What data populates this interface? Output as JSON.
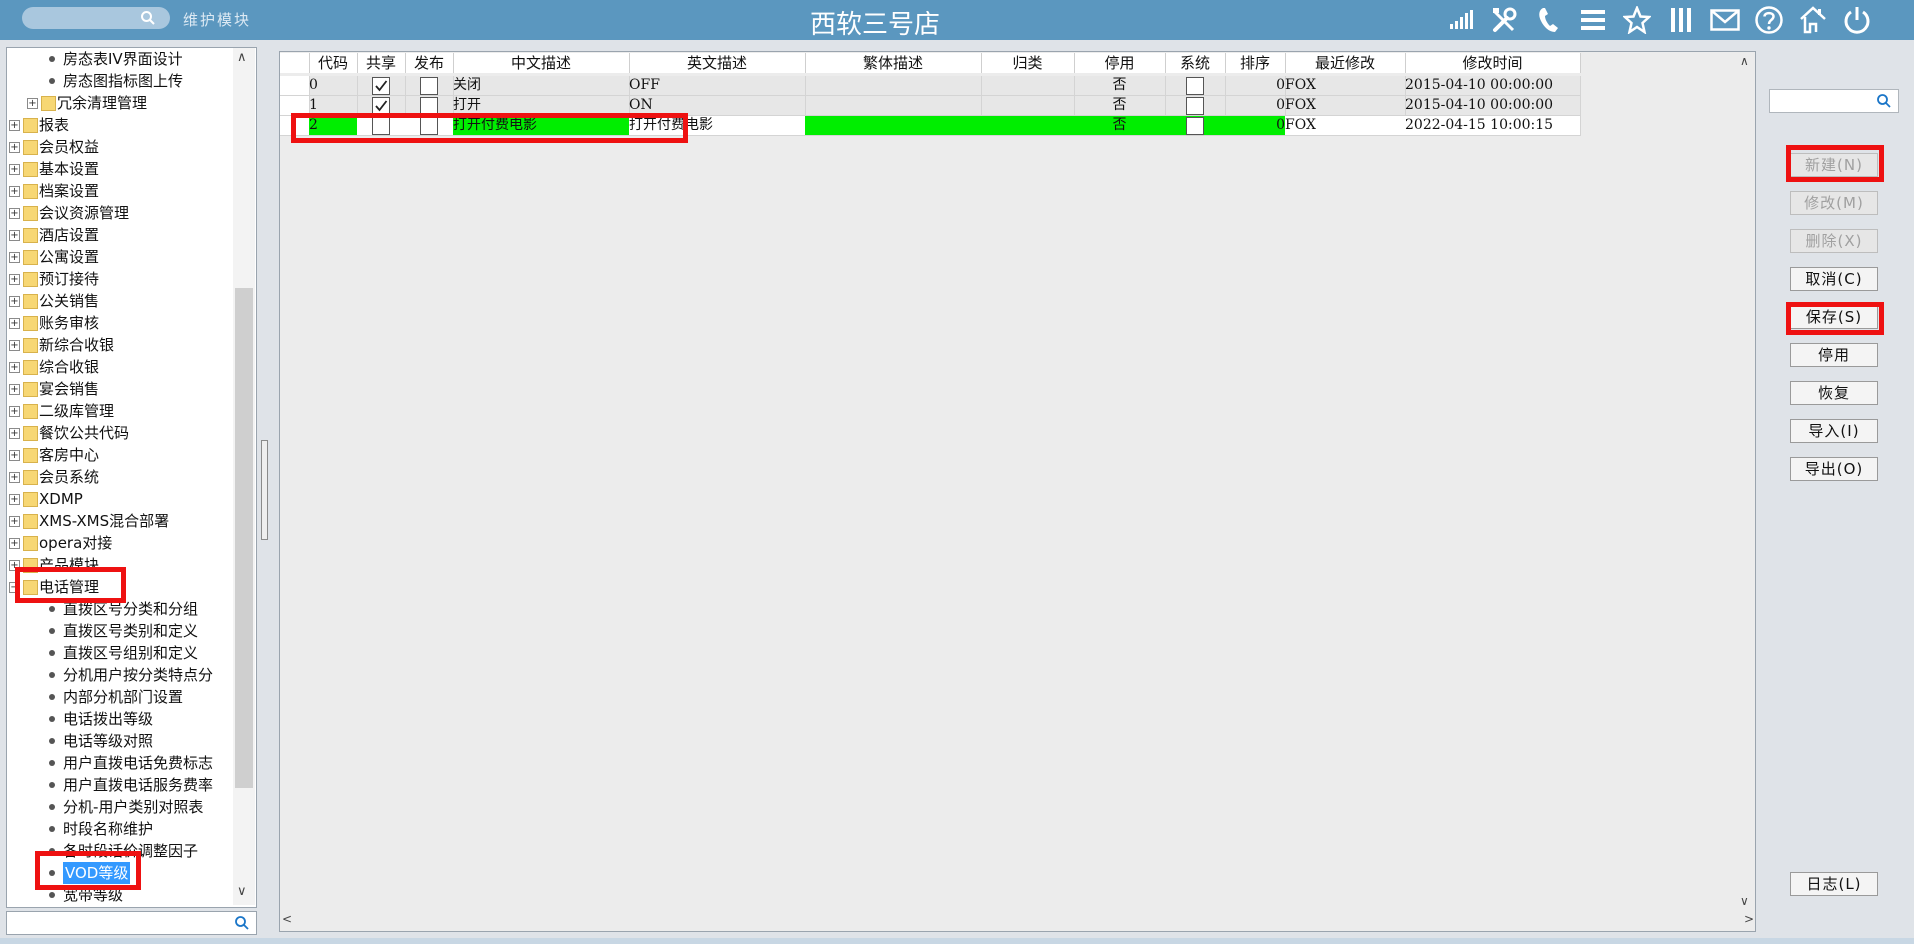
{
  "header": {
    "title": "西软三号店",
    "module_label": "维护模块",
    "icons": [
      "signal-icon",
      "tools-icon",
      "phone-icon",
      "menu-icon",
      "star-icon",
      "columns-icon",
      "mail-icon",
      "help-icon",
      "house-icon",
      "power-icon"
    ]
  },
  "tree": {
    "items": [
      {
        "label": "房态表IV界面设计",
        "type": "leaf",
        "level": 2
      },
      {
        "label": "房态图指标图上传",
        "type": "leaf",
        "level": 2
      },
      {
        "label": "冗余清理管理",
        "type": "folder",
        "level": 1
      },
      {
        "label": "报表",
        "type": "folder",
        "level": 0
      },
      {
        "label": "会员权益",
        "type": "folder",
        "level": 0
      },
      {
        "label": "基本设置",
        "type": "folder",
        "level": 0
      },
      {
        "label": "档案设置",
        "type": "folder",
        "level": 0
      },
      {
        "label": "会议资源管理",
        "type": "folder",
        "level": 0
      },
      {
        "label": "酒店设置",
        "type": "folder",
        "level": 0
      },
      {
        "label": "公寓设置",
        "type": "folder",
        "level": 0
      },
      {
        "label": "预订接待",
        "type": "folder",
        "level": 0
      },
      {
        "label": "公关销售",
        "type": "folder",
        "level": 0
      },
      {
        "label": "账务审核",
        "type": "folder",
        "level": 0
      },
      {
        "label": "新综合收银",
        "type": "folder",
        "level": 0
      },
      {
        "label": "综合收银",
        "type": "folder",
        "level": 0
      },
      {
        "label": "宴会销售",
        "type": "folder",
        "level": 0
      },
      {
        "label": "二级库管理",
        "type": "folder",
        "level": 0
      },
      {
        "label": "餐饮公共代码",
        "type": "folder",
        "level": 0
      },
      {
        "label": "客房中心",
        "type": "folder",
        "level": 0
      },
      {
        "label": "会员系统",
        "type": "folder",
        "level": 0
      },
      {
        "label": "XDMP",
        "type": "folder",
        "level": 0
      },
      {
        "label": "XMS-XMS混合部署",
        "type": "folder",
        "level": 0
      },
      {
        "label": "opera对接",
        "type": "folder",
        "level": 0
      },
      {
        "label": "产品模块",
        "type": "folder",
        "level": 0
      },
      {
        "label": "电话管理",
        "type": "folder-open",
        "level": 0
      },
      {
        "label": "直拨区号分类和分组",
        "type": "leaf",
        "level": 1
      },
      {
        "label": "直拨区号类别和定义",
        "type": "leaf",
        "level": 1
      },
      {
        "label": "直拨区号组别和定义",
        "type": "leaf",
        "level": 1
      },
      {
        "label": "分机用户按分类特点分",
        "type": "leaf",
        "level": 1
      },
      {
        "label": "内部分机部门设置",
        "type": "leaf",
        "level": 1
      },
      {
        "label": "电话拨出等级",
        "type": "leaf",
        "level": 1
      },
      {
        "label": "电话等级对照",
        "type": "leaf",
        "level": 1
      },
      {
        "label": "用户直拨电话免费标志",
        "type": "leaf",
        "level": 1
      },
      {
        "label": "用户直拨电话服务费率",
        "type": "leaf",
        "level": 1
      },
      {
        "label": "分机-用户类别对照表",
        "type": "leaf",
        "level": 1
      },
      {
        "label": "时段名称维护",
        "type": "leaf",
        "level": 1
      },
      {
        "label": "各时段话价调整因子",
        "type": "leaf",
        "level": 1
      },
      {
        "label": "VOD等级",
        "type": "leaf-selected",
        "level": 1
      },
      {
        "label": "宽带等级",
        "type": "leaf",
        "level": 1
      }
    ]
  },
  "grid": {
    "columns": [
      "代码",
      "共享",
      "发布",
      "中文描述",
      "英文描述",
      "繁体描述",
      "归类",
      "停用",
      "系统",
      "排序",
      "最近修改",
      "修改时间"
    ],
    "rows": [
      {
        "code": "0",
        "shared": true,
        "published": false,
        "cn": "关闭",
        "en": "OFF",
        "tw": "",
        "cat": "",
        "disabled": "否",
        "system": false,
        "sort": "0",
        "modifier": "FOX",
        "time": "2015-04-10 00:00:00"
      },
      {
        "code": "1",
        "shared": true,
        "published": false,
        "cn": "打开",
        "en": "ON",
        "tw": "",
        "cat": "",
        "disabled": "否",
        "system": false,
        "sort": "0",
        "modifier": "FOX",
        "time": "2015-04-10 00:00:00"
      },
      {
        "code": "2",
        "shared": false,
        "published": false,
        "cn": "打开付费电影",
        "en": "打开付费电影",
        "tw": "",
        "cat": "",
        "disabled": "否",
        "system": false,
        "sort": "0",
        "modifier": "FOX",
        "time": "2022-04-15 10:00:15"
      }
    ]
  },
  "buttons": {
    "new": "新建(N)",
    "modify": "修改(M)",
    "delete": "删除(X)",
    "cancel": "取消(C)",
    "save": "保存(S)",
    "disable": "停用",
    "restore": "恢复",
    "import": "导入(I)",
    "export": "导出(O)",
    "log": "日志(L)"
  },
  "colors": {
    "header": "#5b97bf",
    "highlight": "#ee1111",
    "edited_row": "#00ee00",
    "selection": "#3399ff"
  }
}
